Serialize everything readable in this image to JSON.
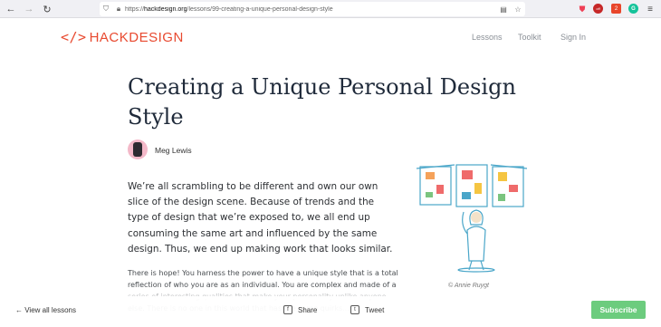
{
  "browser": {
    "url_prefix": "https://",
    "url_domain": "hackdesign.org",
    "url_path": "/lessons/99-creating-a-unique-personal-design-style",
    "back_icon": "arrow-left-icon",
    "forward_icon": "arrow-right-icon",
    "reload_icon": "reload-icon",
    "ublock_badge": "off",
    "honey_badge": "2",
    "grammarly_label": "G"
  },
  "site": {
    "logo_mark": "</>",
    "logo_text_hack": "HACK",
    "logo_text_design": "DESIGN",
    "brand_color": "#e8492f",
    "nav": [
      {
        "label": "Lessons"
      },
      {
        "label": "Toolkit"
      },
      {
        "label": "Sign In"
      }
    ]
  },
  "article": {
    "title": "Creating a Unique Personal Design Style",
    "author": "Meg Lewis",
    "lead": "We’re all scrambling to be different and own our own slice of the design scene. Because of trends and the type of design that we’re exposed to, we all end up consuming the same art and influenced by the same design. Thus, we end up making work that looks similar.",
    "body": "There is hope! You harness the power to have a unique style that is a total reflection of who you are as an individual. You are complex and made of a series of interesting qualities that make your personality unlike anyone else. There is no one in this world that has the same quirks...",
    "image_credit": "© Annie Ruygt"
  },
  "footer_bar": {
    "back_label": "← View all lessons",
    "share_label": "Share",
    "tweet_label": "Tweet",
    "subscribe_label": "Subscribe",
    "subscribe_color": "#6ccc7e"
  }
}
